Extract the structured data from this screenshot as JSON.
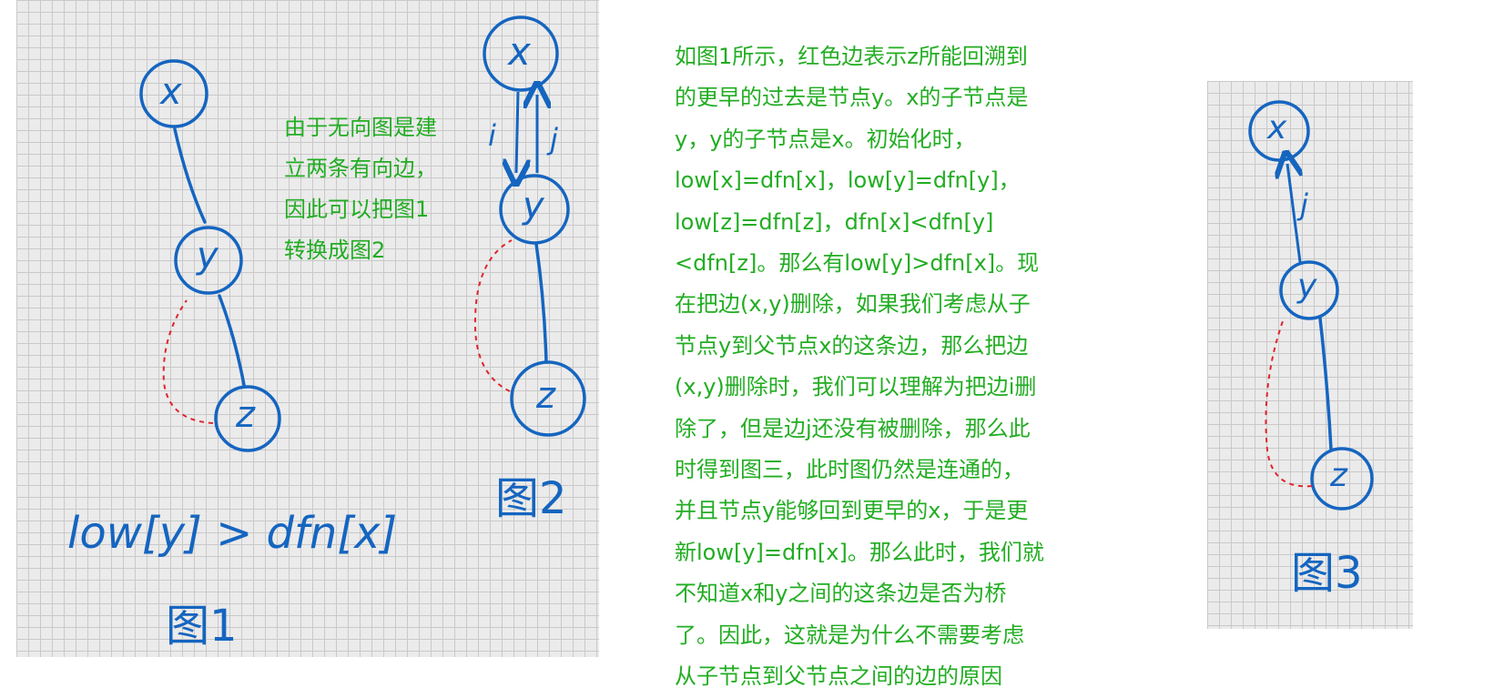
{
  "figure1": {
    "nodes": {
      "x": "x",
      "y": "y",
      "z": "z"
    },
    "formula": "low[y] > dfn[x]",
    "caption": "图1"
  },
  "figure2": {
    "nodes": {
      "x": "x",
      "y": "y",
      "z": "z"
    },
    "edge_labels": {
      "down": "i",
      "up": "j"
    },
    "caption": "图2"
  },
  "figure3": {
    "nodes": {
      "x": "x",
      "y": "y",
      "z": "z"
    },
    "edge_label": "j",
    "caption": "图3"
  },
  "note_lines": [
    "由于无向图是建",
    "立两条有向边，",
    "因此可以把图1",
    "转换成图2"
  ],
  "explanation_lines": [
    "如图1所示，红色边表示z所能回溯到",
    "的更早的过去是节点y。x的子节点是",
    "y，y的子节点是x。初始化时，",
    "low[x]=dfn[x]，low[y]=dfn[y]，",
    "low[z]=dfn[z]，dfn[x]<dfn[y]",
    "<dfn[z]。那么有low[y]>dfn[x]。现",
    "在把边(x,y)删除，如果我们考虑从子",
    "节点y到父节点x的这条边，那么把边",
    "(x,y)删除时，我们可以理解为把边i删",
    "除了，但是边j还没有被删除，那么此",
    "时得到图三，此时图仍然是连通的，",
    "并且节点y能够回到更早的x，于是更",
    "新low[y]=dfn[x]。那么此时，我们就",
    "不知道x和y之间的这条边是否为桥",
    "了。因此，这就是为什么不需要考虑",
    "从子节点到父节点之间的边的原因"
  ],
  "colors": {
    "ink_blue": "#1565c0",
    "back_edge_red": "#e0242b",
    "text_green": "#22ad22",
    "grid_bg": "#ebebeb",
    "grid_line": "#c9c9c9"
  }
}
